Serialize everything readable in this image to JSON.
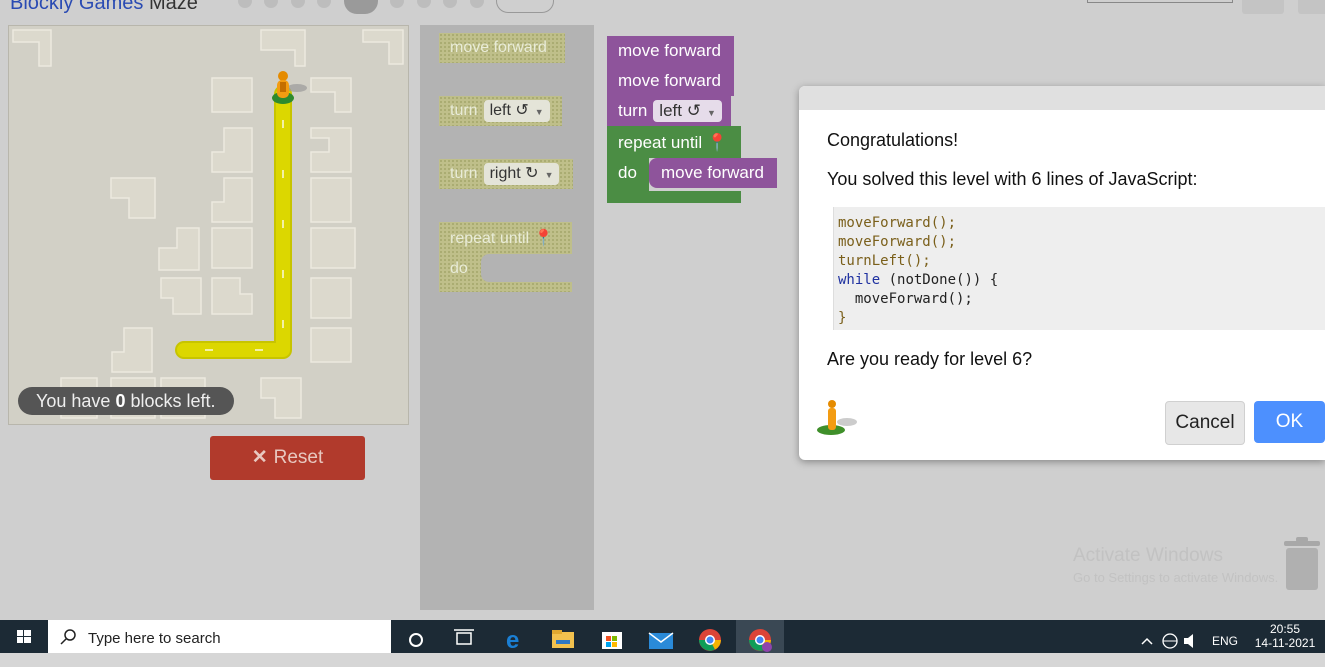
{
  "header": {
    "title_app": "Blockly Games",
    "title_game": "Maze",
    "level_dots": 10,
    "current_level_index": 5
  },
  "maze": {
    "blocks_left_prefix": "You have",
    "blocks_left_count": "0",
    "blocks_left_suffix": "blocks left.",
    "reset_label": "Reset"
  },
  "toolbox": {
    "move_forward": "move forward",
    "turn_left_label": "turn",
    "turn_left_value": "left ↺",
    "turn_right_label": "turn",
    "turn_right_value": "right ↻",
    "repeat_until": "repeat until",
    "do": "do"
  },
  "workspace": {
    "b1": "move forward",
    "b2": "move forward",
    "b3_label": "turn",
    "b3_value": "left ↺",
    "repeat_until": "repeat until",
    "do": "do",
    "inner": "move forward"
  },
  "dialog": {
    "congrats": "Congratulations!",
    "solved": "You solved this level with 6 lines of JavaScript:",
    "code": {
      "l1": "moveForward();",
      "l2": "moveForward();",
      "l3": "turnLeft();",
      "l4_kw": "while",
      "l4_rest": " (notDone()) {",
      "l5": "  moveForward();",
      "l6": "}"
    },
    "question": "Are you ready for level 6?",
    "cancel_label": "Cancel",
    "ok_label": "OK"
  },
  "watermark": {
    "line1": "Activate Windows",
    "line2": "Go to Settings to activate Windows."
  },
  "taskbar": {
    "search_placeholder": "Type here to search",
    "lang": "ENG",
    "time": "20:55",
    "date": "14-11-2021"
  },
  "colors": {
    "path": "#d4cf00",
    "blocks_purple": "#8e549b",
    "blocks_green": "#4b8d44",
    "reset": "#b13a2c",
    "ok": "#4d90fe"
  }
}
